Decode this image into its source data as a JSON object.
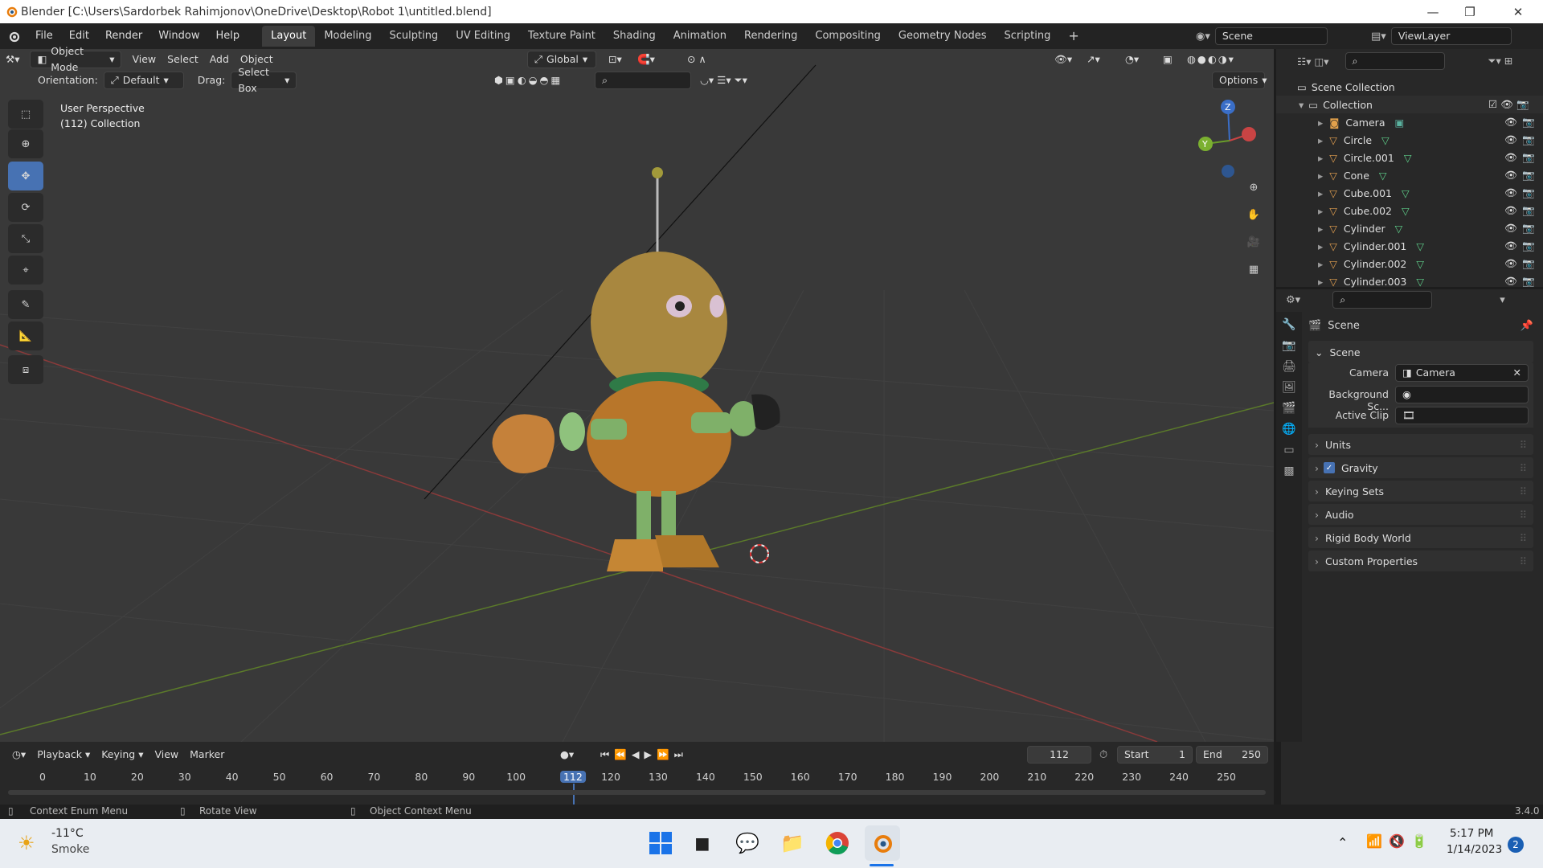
{
  "window": {
    "title": "Blender [C:\\Users\\Sardorbek Rahimjonov\\OneDrive\\Desktop\\Robot 1\\untitled.blend]"
  },
  "topbar": {
    "menus": [
      "File",
      "Edit",
      "Render",
      "Window",
      "Help"
    ],
    "workspaces": [
      "Layout",
      "Modeling",
      "Sculpting",
      "UV Editing",
      "Texture Paint",
      "Shading",
      "Animation",
      "Rendering",
      "Compositing",
      "Geometry Nodes",
      "Scripting"
    ],
    "plus": "+",
    "scene": "Scene",
    "view_layer": "ViewLayer"
  },
  "viewport": {
    "mode": "Object Mode",
    "menus": [
      "View",
      "Select",
      "Add",
      "Object"
    ],
    "transform": "Global",
    "orientation_label": "Orientation:",
    "orientation_value": "Default",
    "drag_label": "Drag:",
    "drag_value": "Select Box",
    "options": "Options",
    "overlay_line1": "User Perspective",
    "overlay_line2": "(112) Collection",
    "gizmo": {
      "z": "Z",
      "y": "Y"
    }
  },
  "outliner": {
    "root": "Scene Collection",
    "collection": "Collection",
    "items": [
      "Camera",
      "Circle",
      "Circle.001",
      "Cone",
      "Cube.001",
      "Cube.002",
      "Cylinder",
      "Cylinder.001",
      "Cylinder.002",
      "Cylinder.003"
    ]
  },
  "properties": {
    "header": "Scene",
    "panel": "Scene",
    "camera_label": "Camera",
    "camera_value": "Camera",
    "bg_label": "Background Sc...",
    "clip_label": "Active Clip",
    "subpanels": [
      "Units",
      "Gravity",
      "Keying Sets",
      "Audio",
      "Rigid Body World",
      "Custom Properties"
    ]
  },
  "timeline": {
    "menus": [
      "Playback",
      "Keying",
      "View",
      "Marker"
    ],
    "current_frame": "112",
    "start_label": "Start",
    "start": "1",
    "end_label": "End",
    "end": "250",
    "ticks": [
      "0",
      "10",
      "20",
      "30",
      "40",
      "50",
      "60",
      "70",
      "80",
      "90",
      "100",
      "112",
      "120",
      "130",
      "140",
      "150",
      "160",
      "170",
      "180",
      "190",
      "200",
      "210",
      "220",
      "230",
      "240",
      "250"
    ]
  },
  "status": {
    "left": "Context Enum Menu",
    "mid": "Rotate View",
    "right": "Object Context Menu",
    "version": "3.4.0"
  },
  "taskbar": {
    "temp": "-11°C",
    "weather": "Smoke",
    "time": "5:17 PM",
    "date": "1/14/2023",
    "badge": "2"
  }
}
